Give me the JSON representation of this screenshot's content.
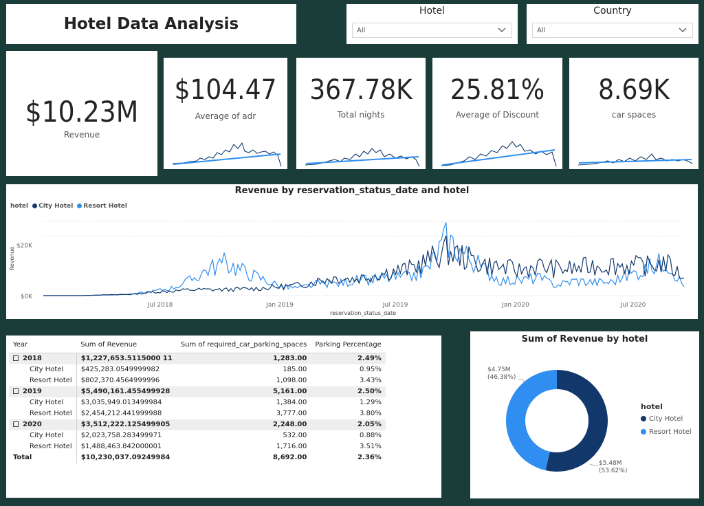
{
  "title": "Hotel Data Analysis",
  "slicers": {
    "hotel": {
      "label": "Hotel",
      "value": "All"
    },
    "country": {
      "label": "Country",
      "value": "All"
    }
  },
  "kpis": [
    {
      "value": "$10.23M",
      "caption": "Revenue"
    },
    {
      "value": "$104.47",
      "caption": "Average of adr"
    },
    {
      "value": "367.78K",
      "caption": "Total nights"
    },
    {
      "value": "25.81%",
      "caption": "Average of Discount"
    },
    {
      "value": "8.69K",
      "caption": "car spaces"
    }
  ],
  "line_chart": {
    "title": "Revenue by reservation_status_date and hotel",
    "legend_title": "hotel",
    "series_names": [
      "City Hotel",
      "Resort Hotel"
    ],
    "y_label": "Revenue",
    "x_label": "reservation_status_date",
    "y_ticks": [
      "$0K",
      "$20K"
    ],
    "x_ticks": [
      "Jul 2018",
      "Jan 2019",
      "Jul 2019",
      "Jan 2020",
      "Jul 2020"
    ]
  },
  "table": {
    "headers": [
      "Year",
      "Sum of Revenue",
      "Sum of required_car_parking_spaces",
      "Parking Percentage"
    ],
    "rows": [
      {
        "label": "2018",
        "revenue": "$1,227,653.5115000 11",
        "parking": "1,283.00",
        "pct": "2.49%",
        "kind": "year"
      },
      {
        "label": "City Hotel",
        "revenue": "$425,283.0549999982",
        "parking": "185.00",
        "pct": "0.95%",
        "kind": "sub"
      },
      {
        "label": "Resort Hotel",
        "revenue": "$802,370.4564999996",
        "parking": "1,098.00",
        "pct": "3.43%",
        "kind": "sub"
      },
      {
        "label": "2019",
        "revenue": "$5,490,161.455499928",
        "parking": "5,161.00",
        "pct": "2.50%",
        "kind": "year"
      },
      {
        "label": "City Hotel",
        "revenue": "$3,035,949.013499984",
        "parking": "1,384.00",
        "pct": "1.29%",
        "kind": "sub"
      },
      {
        "label": "Resort Hotel",
        "revenue": "$2,454,212.441999988",
        "parking": "3,777.00",
        "pct": "3.80%",
        "kind": "sub"
      },
      {
        "label": "2020",
        "revenue": "$3,512,222.125499905",
        "parking": "2,248.00",
        "pct": "2.05%",
        "kind": "year"
      },
      {
        "label": "City Hotel",
        "revenue": "$2,023,758.283499971",
        "parking": "532.00",
        "pct": "0.88%",
        "kind": "sub"
      },
      {
        "label": "Resort Hotel",
        "revenue": "$1,488,463.842000001",
        "parking": "1,716.00",
        "pct": "3.51%",
        "kind": "sub"
      },
      {
        "label": "Total",
        "revenue": "$10,230,037.09249984",
        "parking": "8,692.00",
        "pct": "2.36%",
        "kind": "total"
      }
    ]
  },
  "donut": {
    "title": "Sum of Revenue by hotel",
    "legend_title": "hotel",
    "labels": [
      {
        "value": "$4.75M",
        "pct": "(46.38%)"
      },
      {
        "value": "$5.48M",
        "pct": "(53.62%)"
      }
    ]
  },
  "colors": {
    "city": "#12386b",
    "resort": "#2f8ef0",
    "background": "#1b3d3a"
  },
  "chart_data": [
    {
      "type": "line",
      "title": "Revenue by reservation_status_date and hotel",
      "xlabel": "reservation_status_date",
      "ylabel": "Revenue",
      "x": [
        "2017-10",
        "2017-11",
        "2017-12",
        "2018-01",
        "2018-02",
        "2018-03",
        "2018-04",
        "2018-05",
        "2018-06",
        "2018-07",
        "2018-08",
        "2018-09",
        "2018-10",
        "2018-11",
        "2018-12",
        "2019-01",
        "2019-02",
        "2019-03",
        "2019-04",
        "2019-05",
        "2019-06",
        "2019-07",
        "2019-08",
        "2019-09",
        "2019-10",
        "2019-11",
        "2019-12",
        "2020-01",
        "2020-02",
        "2020-03",
        "2020-04",
        "2020-05",
        "2020-06",
        "2020-07",
        "2020-08",
        "2020-09"
      ],
      "series": [
        {
          "name": "City Hotel",
          "values": [
            0,
            0,
            0,
            200,
            300,
            500,
            1200,
            1500,
            2000,
            2000,
            2000,
            2200,
            2500,
            3000,
            3500,
            5000,
            6000,
            5500,
            7000,
            8000,
            9000,
            12000,
            15000,
            13000,
            10500,
            9500,
            8500,
            10000,
            9000,
            9000,
            10000,
            10500,
            10000,
            10000,
            11000,
            6000
          ]
        },
        {
          "name": "Resort Hotel",
          "values": [
            0,
            0,
            0,
            200,
            300,
            600,
            1500,
            2500,
            5000,
            9000,
            11000,
            8000,
            5500,
            3000,
            2500,
            4000,
            4000,
            5000,
            5500,
            6000,
            6000,
            9000,
            19000,
            14000,
            9000,
            5000,
            5000,
            6000,
            3500,
            5000,
            4500,
            4500,
            7000,
            9000,
            12000,
            3000
          ]
        }
      ],
      "ylim": [
        0,
        25000
      ],
      "y_ticks": [
        0,
        20000
      ]
    },
    {
      "type": "pie",
      "title": "Sum of Revenue by hotel",
      "categories": [
        "City Hotel",
        "Resort Hotel"
      ],
      "values": [
        5.48,
        4.75
      ],
      "percent": [
        53.62,
        46.38
      ]
    }
  ]
}
